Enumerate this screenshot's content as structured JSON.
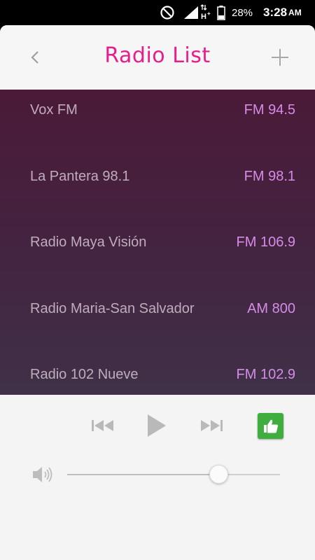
{
  "status_bar": {
    "icons": [
      "do-not-disturb-icon",
      "signal-icon",
      "data-hplus-icon",
      "battery-icon"
    ],
    "battery": "28%",
    "time": "3:28",
    "ampm": "AM"
  },
  "header": {
    "title": "Radio List",
    "back_icon": "chevron-left-icon",
    "add_icon": "plus-icon"
  },
  "stations": [
    {
      "name": "Vox FM",
      "freq": "FM 94.5"
    },
    {
      "name": "La Pantera 98.1",
      "freq": "FM 98.1"
    },
    {
      "name": "Radio Maya Visión",
      "freq": "FM 106.9"
    },
    {
      "name": "Radio Maria-San Salvador",
      "freq": "AM 800"
    },
    {
      "name": "Radio 102 Nueve",
      "freq": "FM 102.9"
    }
  ],
  "player": {
    "controls": [
      "previous-icon",
      "play-icon",
      "next-icon",
      "thumbs-up-icon"
    ],
    "volume_level": 0.71
  },
  "colors": {
    "accent": "#e61e8c",
    "station_name": "#c0adbc",
    "station_freq": "#d58ce6",
    "list_bg_top": "#4a1a38",
    "list_bg_bottom": "#403148",
    "like_green": "#3fae3f"
  }
}
